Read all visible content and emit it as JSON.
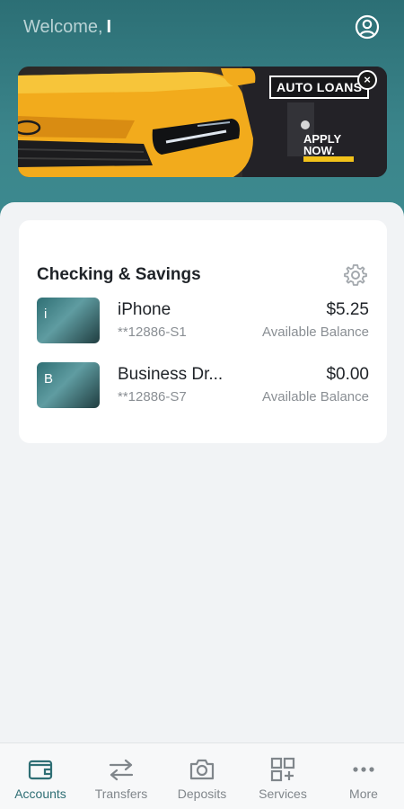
{
  "header": {
    "welcome_text": "Welcome,",
    "user_name": "I"
  },
  "banner": {
    "headline": "AUTO LOANS",
    "cta": "APPLY NOW.",
    "close_glyph": "×"
  },
  "checking_card": {
    "title": "Checking & Savings",
    "accounts": [
      {
        "initial": "i",
        "name": "iPhone",
        "number": "**12886-S1",
        "amount": "$5.25",
        "balance_label": "Available Balance"
      },
      {
        "initial": "B",
        "name": "Business Dr...",
        "number": "**12886-S7",
        "amount": "$0.00",
        "balance_label": "Available Balance"
      }
    ]
  },
  "bottom_nav": {
    "items": [
      {
        "label": "Accounts",
        "icon": "wallet-icon",
        "active": true
      },
      {
        "label": "Transfers",
        "icon": "transfer-arrows-icon",
        "active": false
      },
      {
        "label": "Deposits",
        "icon": "camera-icon",
        "active": false
      },
      {
        "label": "Services",
        "icon": "grid-plus-icon",
        "active": false
      },
      {
        "label": "More",
        "icon": "more-dots-icon",
        "active": false
      }
    ]
  },
  "colors": {
    "brand_teal": "#2e6e74",
    "banner_yellow": "#f2c21a",
    "muted_text": "#8a8f94"
  }
}
